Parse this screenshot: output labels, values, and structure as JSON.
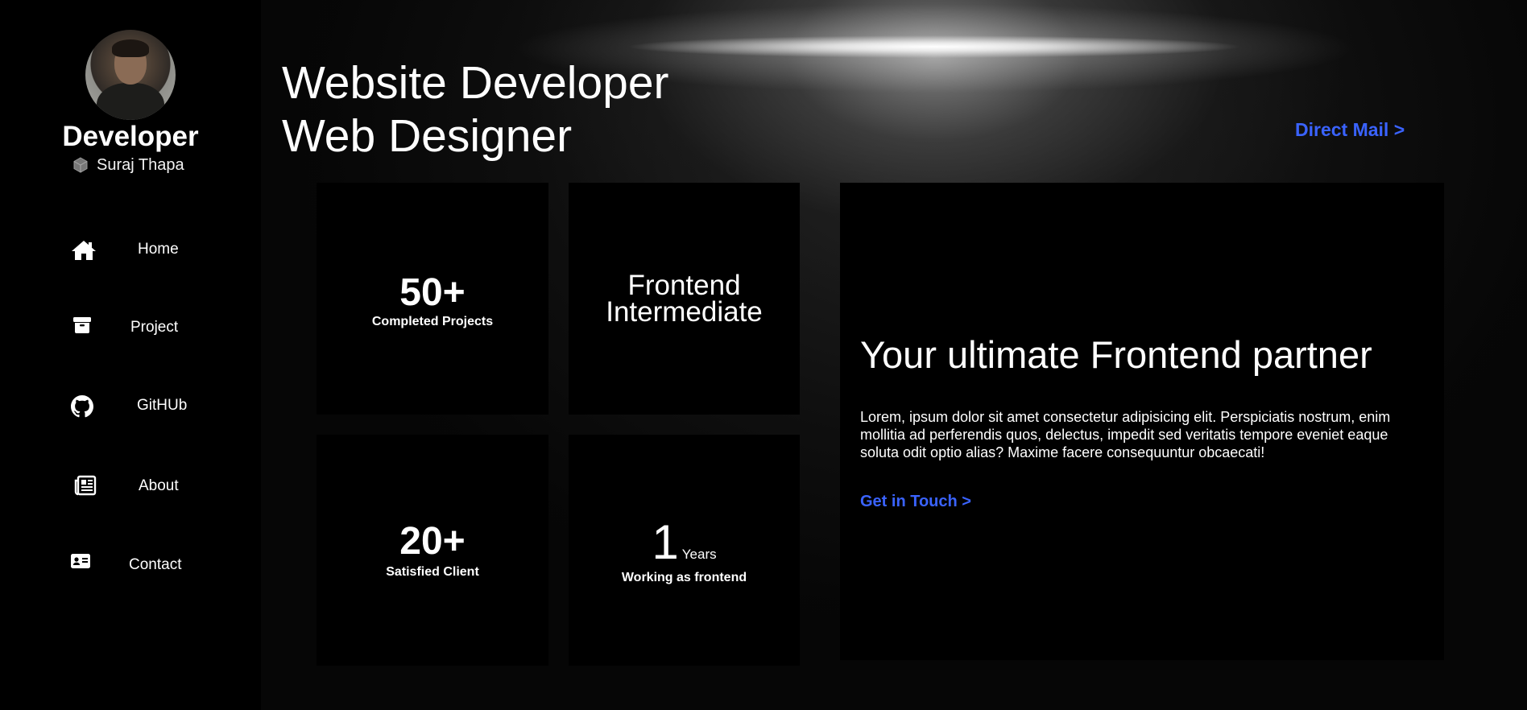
{
  "sidebar": {
    "brand_title": "Developer",
    "brand_name": "Suraj Thapa",
    "brand_icon": "hexagon-logo-icon",
    "items": [
      {
        "label": "Home",
        "icon": "home-icon"
      },
      {
        "label": "Project",
        "icon": "archive-box-icon"
      },
      {
        "label": "GitHUb",
        "icon": "github-icon"
      },
      {
        "label": "About",
        "icon": "newspaper-icon"
      },
      {
        "label": "Contact",
        "icon": "id-card-icon"
      }
    ]
  },
  "header": {
    "headline_line1": "Website Developer",
    "headline_line2": "Web Designer",
    "direct_mail": "Direct Mail >"
  },
  "stats": {
    "projects": {
      "value": "50+",
      "label": "Completed Projects"
    },
    "level": {
      "line1": "Frontend",
      "line2": "Intermediate"
    },
    "clients": {
      "value": "20+",
      "label": "Satisfied Client"
    },
    "experience": {
      "value": "1",
      "unit": "Years",
      "label": "Working as frontend"
    }
  },
  "panel": {
    "title": "Your ultimate Frontend partner",
    "text": "Lorem, ipsum dolor sit amet consectetur adipisicing elit. Perspiciatis nostrum, enim mollitia ad perferendis quos, delectus, impedit sed veritatis tempore eveniet eaque soluta odit optio alias? Maxime facere consequuntur obcaecati!",
    "cta": "Get in Touch >"
  },
  "colors": {
    "background": "#000000",
    "link_accent": "#3a63ff",
    "text": "#ffffff"
  }
}
